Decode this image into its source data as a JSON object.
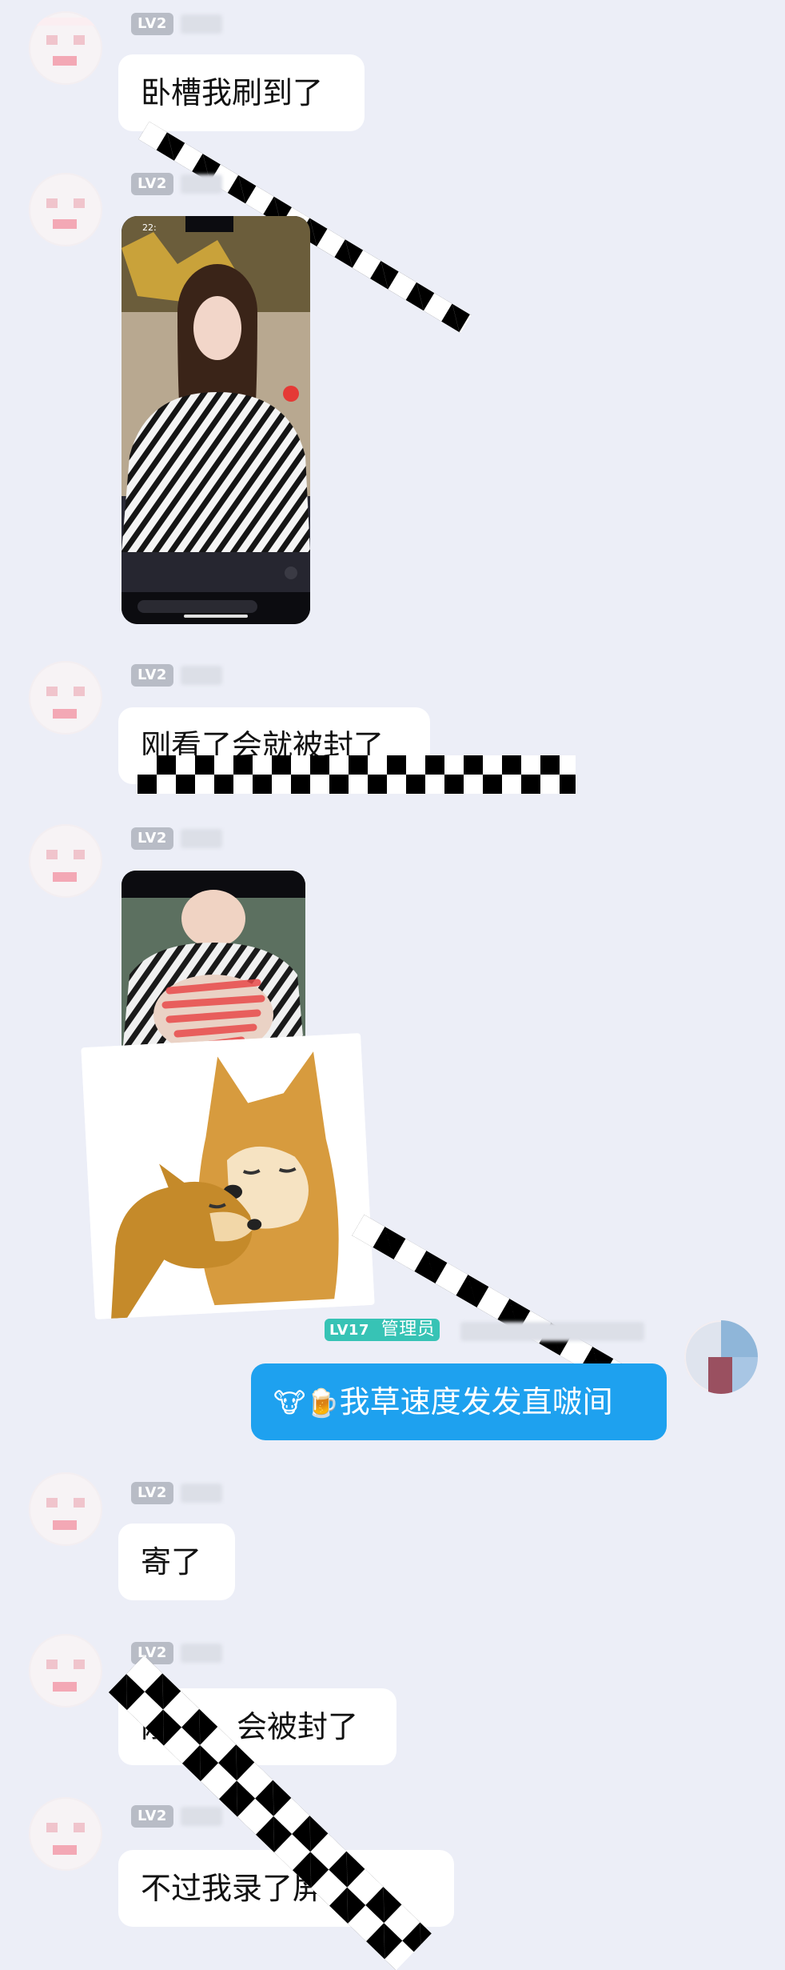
{
  "messages": [
    {
      "level": "LV2",
      "text": "卧槽我刷到了"
    },
    {
      "level": "LV2",
      "image": "livestream-screenshot",
      "overlay_text": "22:"
    },
    {
      "level": "LV2",
      "text": "刚看了会就被封了"
    },
    {
      "level": "LV2",
      "image": "censored-video-frame",
      "sticker": "doge-hug-sticker"
    },
    {
      "level": "LV17",
      "role": "管理员",
      "emoji": "🐮🍺",
      "text": "我草速度发发直啵间"
    },
    {
      "level": "LV2",
      "text": "寄了"
    },
    {
      "level": "LV2",
      "text": "刚",
      "text_after": "会被封了"
    },
    {
      "level": "LV2",
      "text": "不过我录了屏我"
    }
  ],
  "colors": {
    "background": "#eceef7",
    "bubble": "#ffffff",
    "my_bubble": "#1ea1ef",
    "level_badge": "#b8bcc6",
    "admin_badge": "#37c3b5"
  }
}
